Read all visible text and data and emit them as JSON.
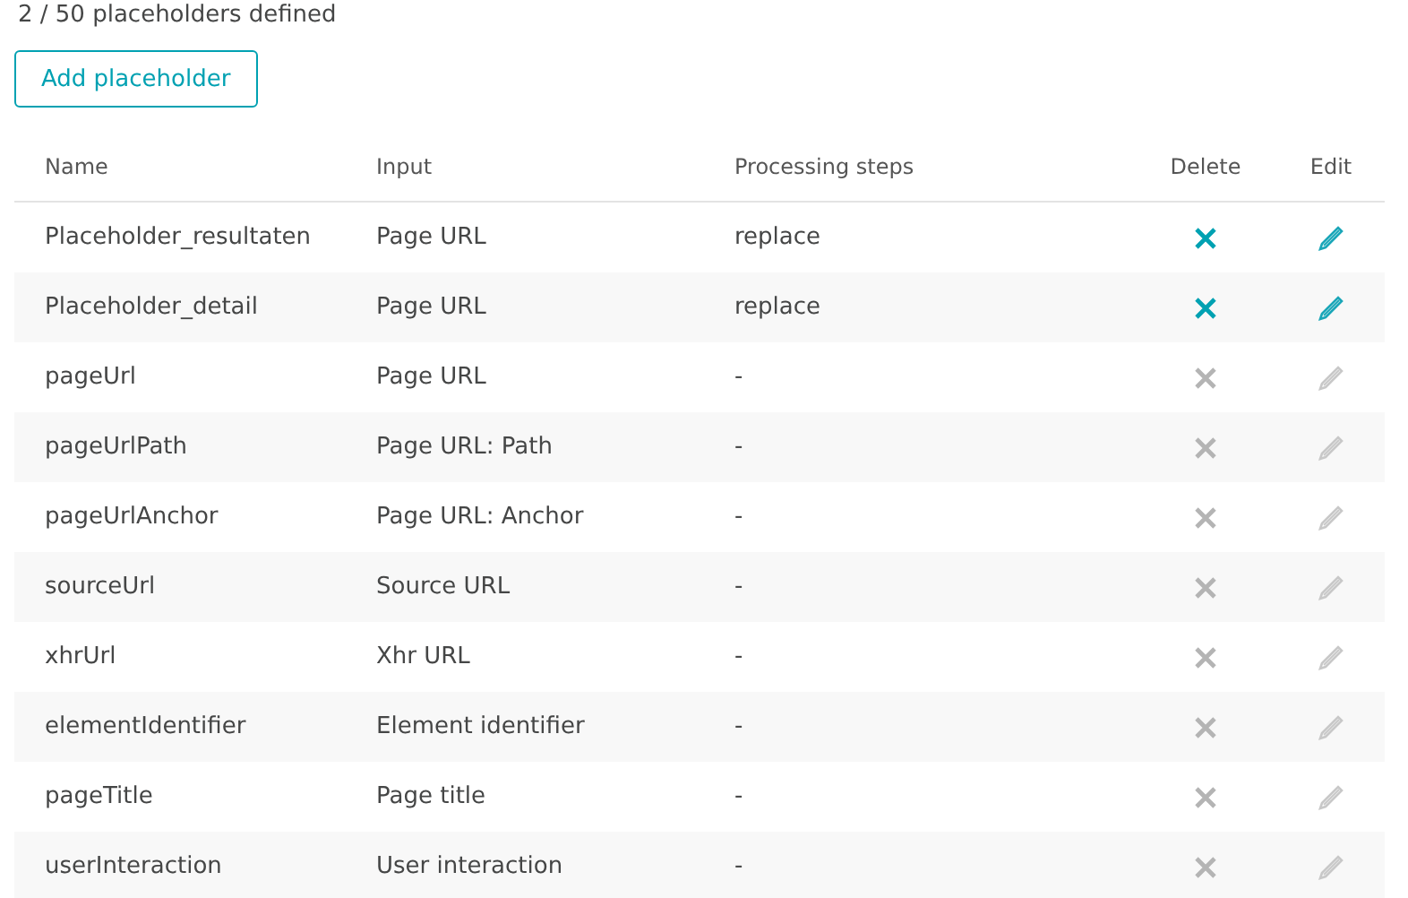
{
  "summary": "2 / 50 placeholders defined",
  "add_button": "Add placeholder",
  "table": {
    "columns": [
      "Name",
      "Input",
      "Processing steps",
      "Delete",
      "Edit"
    ],
    "rows": [
      {
        "name": "Placeholder_resultaten",
        "input": "Page URL",
        "processing": "replace",
        "disabled": false
      },
      {
        "name": "Placeholder_detail",
        "input": "Page URL",
        "processing": "replace",
        "disabled": false
      },
      {
        "name": "pageUrl",
        "input": "Page URL",
        "processing": "-",
        "disabled": true
      },
      {
        "name": "pageUrlPath",
        "input": "Page URL: Path",
        "processing": "-",
        "disabled": true
      },
      {
        "name": "pageUrlAnchor",
        "input": "Page URL: Anchor",
        "processing": "-",
        "disabled": true
      },
      {
        "name": "sourceUrl",
        "input": "Source URL",
        "processing": "-",
        "disabled": true
      },
      {
        "name": "xhrUrl",
        "input": "Xhr URL",
        "processing": "-",
        "disabled": true
      },
      {
        "name": "elementIdentifier",
        "input": "Element identifier",
        "processing": "-",
        "disabled": true
      },
      {
        "name": "pageTitle",
        "input": "Page title",
        "processing": "-",
        "disabled": true
      },
      {
        "name": "userInteraction",
        "input": "User interaction",
        "processing": "-",
        "disabled": true
      }
    ]
  }
}
